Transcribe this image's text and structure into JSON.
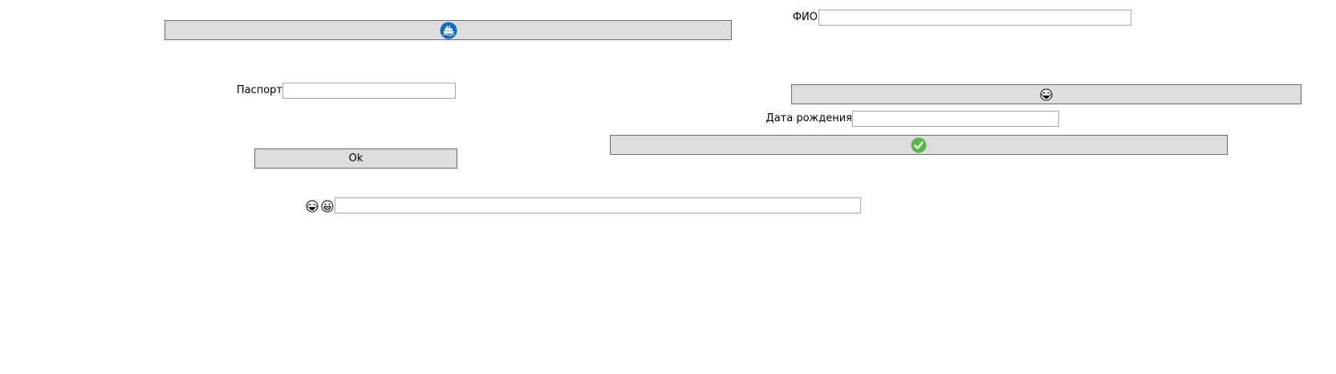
{
  "form": {
    "fio_label": "ФИО",
    "fio_value": "",
    "passport_label": "Паспорт",
    "passport_value": "",
    "birthdate_label": "Дата рождения",
    "birthdate_value": "",
    "ok_button_label": "Ok",
    "emoji_field_value": ""
  },
  "icons": {
    "top_button_icon": "ship-icon",
    "right_button_icon": "laughing-face-icon",
    "check_button_icon": "check-circle-icon",
    "row_icons": [
      "laughing-face-icon",
      "grinning-face-icon"
    ]
  },
  "colors": {
    "button_bg": "#dddddd",
    "ship_icon_bg": "#0a6cc4",
    "check_icon_bg": "#56b947"
  }
}
